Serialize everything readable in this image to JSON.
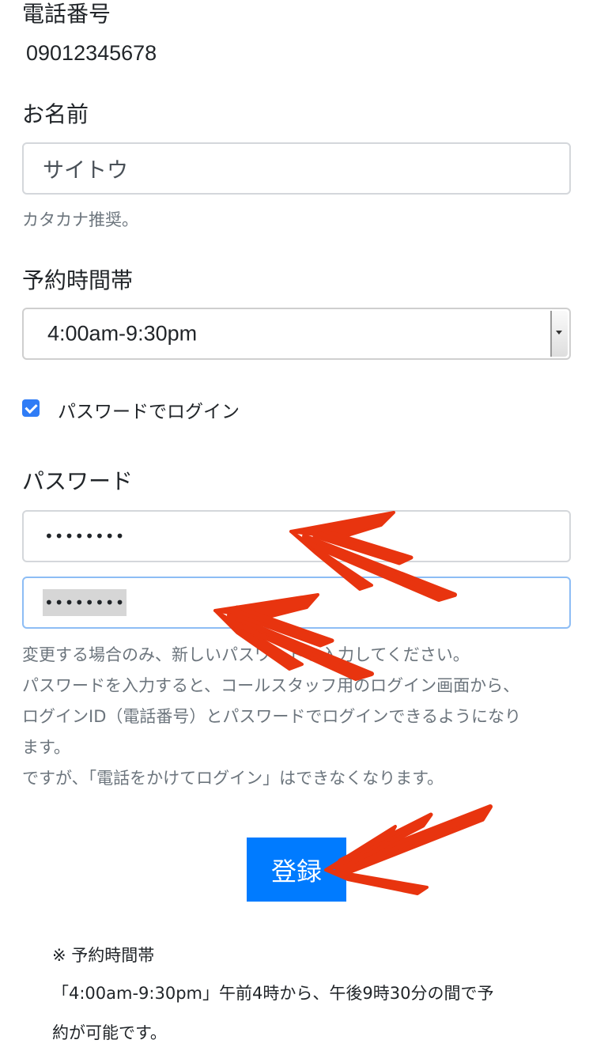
{
  "phone": {
    "label": "電話番号",
    "value": "09012345678"
  },
  "name": {
    "label": "お名前",
    "value": "サイトウ",
    "help": "カタカナ推奨。"
  },
  "time_slot": {
    "label": "予約時間帯",
    "selected": "4:00am-9:30pm"
  },
  "password_login": {
    "checked": true,
    "label": "パスワードでログイン"
  },
  "password": {
    "label": "パスワード",
    "field1_mask": "••••••••",
    "field2_mask": "••••••••",
    "help_lines": [
      "変更する場合のみ、新しいパスワードを入力してください。",
      "パスワードを入力すると、コールスタッフ用のログイン画面から、",
      "ログインID（電話番号）とパスワードでログインできるようになり",
      "ます。",
      "ですが、「電話をかけてログイン」はできなくなります。"
    ]
  },
  "submit": {
    "label": "登録"
  },
  "note": {
    "title": "※ 予約時間帯",
    "lines": [
      "「4:00am-9:30pm」午前4時から、午後9時30分の間で予",
      "約が可能です。"
    ]
  },
  "colors": {
    "accent": "#007bff",
    "annotation_arrow": "#e8340f",
    "help_text": "#6c757d"
  }
}
